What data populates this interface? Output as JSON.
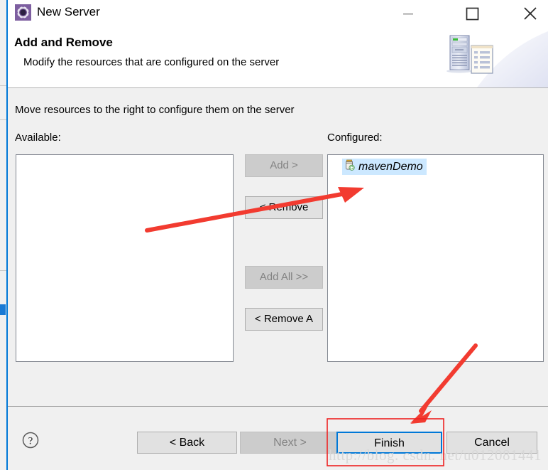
{
  "window": {
    "title": "New Server",
    "icon": "server-gear-icon",
    "controls": {
      "minimize": "minimize-icon",
      "maximize": "maximize-icon",
      "close": "close-icon"
    }
  },
  "header": {
    "title": "Add and Remove",
    "subtitle": "Modify the resources that are configured on the server",
    "art_icon": "server-and-document-icon"
  },
  "main": {
    "instructions": "Move resources to the right to configure them on the server",
    "available": {
      "label": "Available:",
      "items": []
    },
    "configured": {
      "label": "Configured:",
      "items": [
        {
          "name": "mavenDemo",
          "icon": "module-jar-icon",
          "selected": true
        }
      ]
    },
    "transfer_buttons": [
      {
        "label": "Add >",
        "enabled": false
      },
      {
        "label": "< Remove",
        "enabled": true
      },
      {
        "label": "Add All >>",
        "enabled": false
      },
      {
        "label": "< Remove A",
        "enabled": true
      }
    ]
  },
  "footer": {
    "help_icon": "help-question-icon",
    "buttons": [
      {
        "label": "< Back",
        "enabled": true,
        "default": false
      },
      {
        "label": "Next >",
        "enabled": false,
        "default": false
      },
      {
        "label": "Finish",
        "enabled": true,
        "default": true
      },
      {
        "label": "Cancel",
        "enabled": true,
        "default": false
      }
    ]
  },
  "annotations": {
    "color": "#f23b30",
    "highlight_box_color": "#ee2222",
    "arrow_to_configured_item": "arrow-pointing-to-maven-demo",
    "arrow_to_finish": "arrow-pointing-to-finish-button"
  },
  "watermark": {
    "text": "http://blog. csdn. net/u012081441"
  },
  "colors": {
    "accent": "#0078d7",
    "dialog_bg": "#f0f0f0",
    "selection": "#cce8ff",
    "annotation_red": "#f23b30"
  }
}
